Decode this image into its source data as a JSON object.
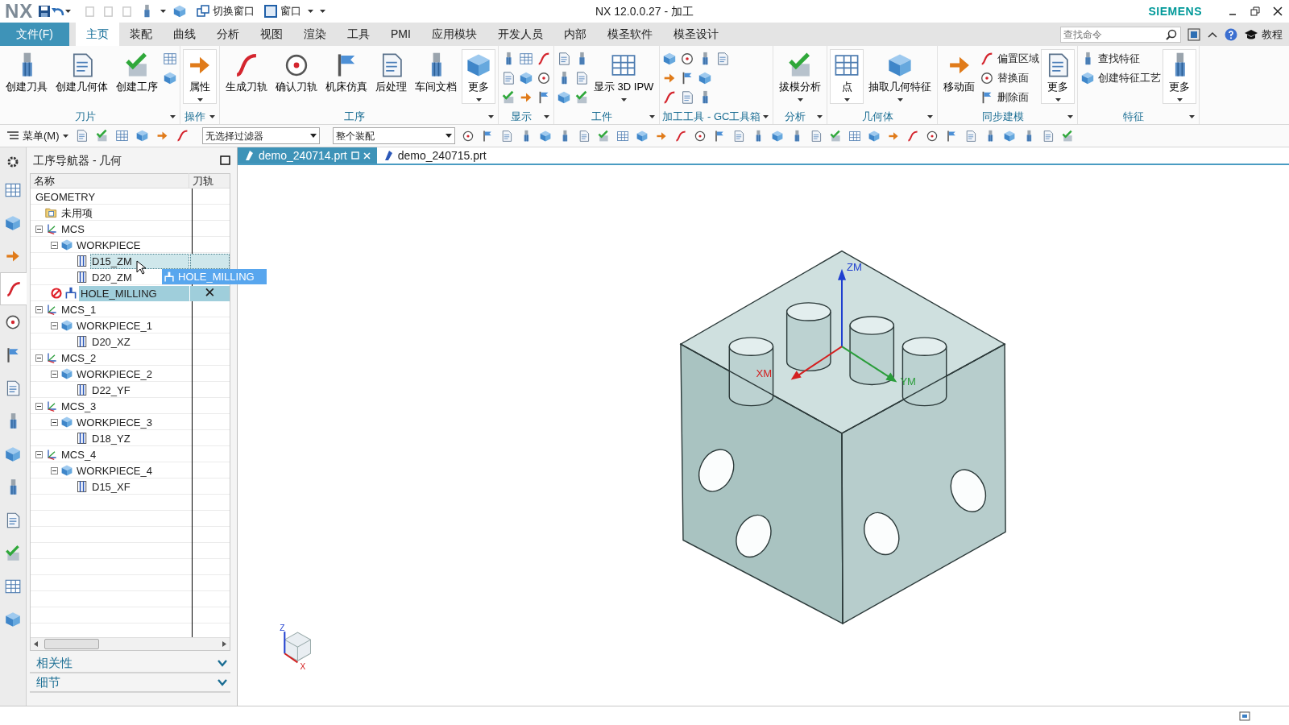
{
  "window": {
    "logo": "NX",
    "title": "NX 12.0.0.27 - 加工",
    "brand": "SIEMENS"
  },
  "quick_access": [
    {
      "label": "切换窗口"
    },
    {
      "label": "窗口"
    }
  ],
  "menu_tabs": [
    {
      "label": "文件(F)",
      "kind": "file",
      "selected": false
    },
    {
      "label": "主页",
      "kind": "tab",
      "selected": true
    },
    {
      "label": "装配",
      "kind": "tab",
      "selected": false
    },
    {
      "label": "曲线",
      "kind": "tab",
      "selected": false
    },
    {
      "label": "分析",
      "kind": "tab",
      "selected": false
    },
    {
      "label": "视图",
      "kind": "tab",
      "selected": false
    },
    {
      "label": "渲染",
      "kind": "tab",
      "selected": false
    },
    {
      "label": "工具",
      "kind": "tab",
      "selected": false
    },
    {
      "label": "PMI",
      "kind": "tab",
      "selected": false
    },
    {
      "label": "应用模块",
      "kind": "tab",
      "selected": false
    },
    {
      "label": "开发人员",
      "kind": "tab",
      "selected": false
    },
    {
      "label": "内部",
      "kind": "tab",
      "selected": false
    },
    {
      "label": "模圣软件",
      "kind": "tab",
      "selected": false
    },
    {
      "label": "模圣设计",
      "kind": "tab",
      "selected": false
    }
  ],
  "search": {
    "placeholder": "查找命令"
  },
  "help_label": "教程",
  "ribbon": [
    {
      "label": "刀片",
      "tools": [
        {
          "kind": "large",
          "label": "创建刀具",
          "dropdown": false
        },
        {
          "kind": "large",
          "label": "创建几何体",
          "dropdown": false
        },
        {
          "kind": "large",
          "label": "创建工序",
          "dropdown": false
        },
        {
          "kind": "icon"
        },
        {
          "kind": "icon"
        }
      ]
    },
    {
      "label": "操作",
      "tools": [
        {
          "kind": "large",
          "label": "属性",
          "dropdown": true
        }
      ]
    },
    {
      "label": "工序",
      "tools": [
        {
          "kind": "large",
          "label": "生成刀轨",
          "dropdown": false
        },
        {
          "kind": "large",
          "label": "确认刀轨",
          "dropdown": false
        },
        {
          "kind": "large",
          "label": "机床仿真",
          "dropdown": false
        },
        {
          "kind": "large",
          "label": "后处理",
          "dropdown": false
        },
        {
          "kind": "large",
          "label": "车间文档",
          "dropdown": false
        },
        {
          "kind": "large",
          "label": "更多",
          "dropdown": true
        }
      ]
    },
    {
      "label": "显示",
      "tools": [
        {
          "kind": "icon"
        },
        {
          "kind": "icon"
        },
        {
          "kind": "icon"
        },
        {
          "kind": "icon"
        },
        {
          "kind": "icon"
        },
        {
          "kind": "icon"
        },
        {
          "kind": "icon"
        },
        {
          "kind": "icon"
        },
        {
          "kind": "icon"
        }
      ]
    },
    {
      "label": "工件",
      "tools": [
        {
          "kind": "icon"
        },
        {
          "kind": "icon"
        },
        {
          "kind": "icon"
        },
        {
          "kind": "icon"
        },
        {
          "kind": "icon"
        },
        {
          "kind": "icon"
        },
        {
          "kind": "large",
          "label": "显示 3D IPW",
          "dropdown": true
        }
      ]
    },
    {
      "label": "加工工具 - GC工具箱",
      "tools": [
        {
          "kind": "icon"
        },
        {
          "kind": "icon"
        },
        {
          "kind": "icon"
        },
        {
          "kind": "icon"
        },
        {
          "kind": "icon"
        },
        {
          "kind": "icon"
        },
        {
          "kind": "icon"
        },
        {
          "kind": "icon"
        },
        {
          "kind": "icon"
        },
        {
          "kind": "icon"
        }
      ]
    },
    {
      "label": "分析",
      "tools": [
        {
          "kind": "large",
          "label": "拔模分析",
          "dropdown": true
        }
      ]
    },
    {
      "label": "几何体",
      "tools": [
        {
          "kind": "large",
          "label": "点",
          "dropdown": true
        },
        {
          "kind": "large",
          "label": "抽取几何特征",
          "dropdown": true
        }
      ]
    },
    {
      "label": "同步建模",
      "tools": [
        {
          "kind": "large",
          "label": "移动面",
          "dropdown": false
        },
        {
          "kind": "small",
          "label": "偏置区域"
        },
        {
          "kind": "small",
          "label": "替换面"
        },
        {
          "kind": "small",
          "label": "删除面"
        },
        {
          "kind": "large",
          "label": "更多",
          "dropdown": true
        }
      ]
    },
    {
      "label": "特征",
      "tools": [
        {
          "kind": "small",
          "label": "查找特征"
        },
        {
          "kind": "small",
          "label": "创建特征工艺"
        },
        {
          "kind": "large",
          "label": "更多",
          "dropdown": true
        }
      ]
    }
  ],
  "toolbar": {
    "menu_label": "菜单(M)",
    "filters": [
      {
        "value": "无选择过滤器"
      },
      {
        "value": "整个装配"
      }
    ]
  },
  "resource_bar": [
    {
      "selected": false
    },
    {
      "selected": false
    },
    {
      "selected": false
    },
    {
      "selected": false
    },
    {
      "selected": true
    },
    {
      "selected": false
    },
    {
      "selected": false
    },
    {
      "selected": false
    },
    {
      "selected": false
    },
    {
      "selected": false
    },
    {
      "selected": false
    },
    {
      "selected": false
    },
    {
      "selected": false
    },
    {
      "selected": false
    },
    {
      "selected": false
    }
  ],
  "navigator": {
    "title": "工序导航器 - 几何",
    "columns": [
      "名称",
      "刀轨"
    ],
    "tree": [
      {
        "name": "GEOMETRY",
        "kind": "root",
        "selected": false,
        "drop_target": false,
        "children": [
          {
            "name": "未用项",
            "kind": "folder",
            "selected": false,
            "drop_target": false
          },
          {
            "name": "MCS",
            "kind": "mcs",
            "expanded": true,
            "selected": false,
            "drop_target": false,
            "children": [
              {
                "name": "WORKPIECE",
                "kind": "workpiece",
                "expanded": true,
                "selected": false,
                "drop_target": false,
                "children": [
                  {
                    "name": "D15_ZM",
                    "kind": "geometry",
                    "selected": false,
                    "drop_target": true
                  },
                  {
                    "name": "D20_ZM",
                    "kind": "geometry",
                    "selected": false,
                    "drop_target": false
                  }
                ]
              },
              {
                "name": "HOLE_MILLING",
                "kind": "operation",
                "selected": true,
                "drop_target": false,
                "invalid": true,
                "toolpath": "✕"
              }
            ]
          },
          {
            "name": "MCS_1",
            "kind": "mcs",
            "expanded": true,
            "selected": false,
            "drop_target": false,
            "children": [
              {
                "name": "WORKPIECE_1",
                "kind": "workpiece",
                "expanded": true,
                "selected": false,
                "drop_target": false,
                "children": [
                  {
                    "name": "D20_XZ",
                    "kind": "geometry",
                    "selected": false,
                    "drop_target": false
                  }
                ]
              }
            ]
          },
          {
            "name": "MCS_2",
            "kind": "mcs",
            "expanded": true,
            "selected": false,
            "drop_target": false,
            "children": [
              {
                "name": "WORKPIECE_2",
                "kind": "workpiece",
                "expanded": true,
                "selected": false,
                "drop_target": false,
                "children": [
                  {
                    "name": "D22_YF",
                    "kind": "geometry",
                    "selected": false,
                    "drop_target": false
                  }
                ]
              }
            ]
          },
          {
            "name": "MCS_3",
            "kind": "mcs",
            "expanded": true,
            "selected": false,
            "drop_target": false,
            "children": [
              {
                "name": "WORKPIECE_3",
                "kind": "workpiece",
                "expanded": true,
                "selected": false,
                "drop_target": false,
                "children": [
                  {
                    "name": "D18_YZ",
                    "kind": "geometry",
                    "selected": false,
                    "drop_target": false
                  }
                ]
              }
            ]
          },
          {
            "name": "MCS_4",
            "kind": "mcs",
            "expanded": true,
            "selected": false,
            "drop_target": false,
            "children": [
              {
                "name": "WORKPIECE_4",
                "kind": "workpiece",
                "expanded": true,
                "selected": false,
                "drop_target": false,
                "children": [
                  {
                    "name": "D15_XF",
                    "kind": "geometry",
                    "selected": false,
                    "drop_target": false
                  }
                ]
              }
            ]
          }
        ]
      }
    ],
    "drag_label": "HOLE_MILLING",
    "sections": [
      {
        "label": "相关性",
        "expanded": false
      },
      {
        "label": "细节",
        "expanded": false
      }
    ]
  },
  "documents": [
    {
      "name": "demo_240714.prt",
      "selected": true
    },
    {
      "name": "demo_240715.prt",
      "selected": false
    }
  ],
  "viewport": {
    "axes": [
      {
        "label": "ZM"
      },
      {
        "label": "XM"
      },
      {
        "label": "YM"
      }
    ],
    "view_triad": [
      "Z",
      "X"
    ]
  }
}
